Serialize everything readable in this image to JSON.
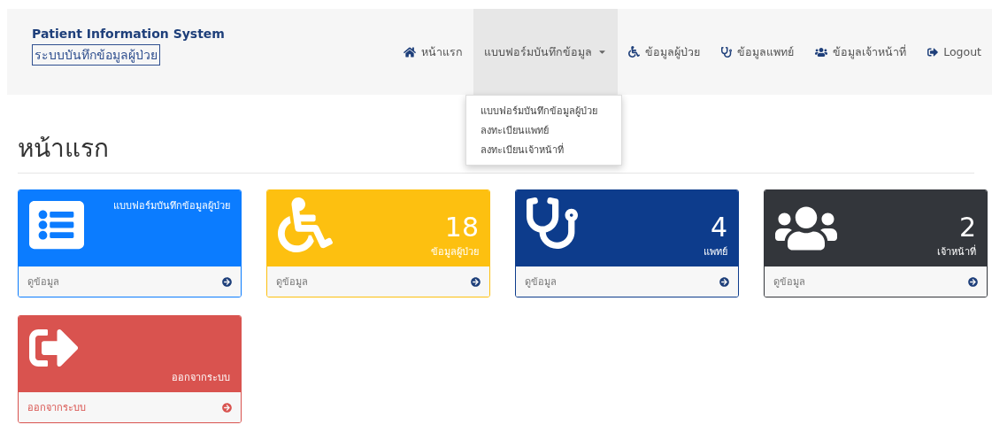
{
  "brand": {
    "title": "Patient Information System",
    "subtitle": "ระบบบันทึกข้อมูลผู้ป่วย"
  },
  "nav": [
    {
      "label": "หน้าแรก",
      "kind": "link",
      "active": false
    },
    {
      "label": "แบบฟอร์มบันทึกข้อมูล",
      "kind": "dropdown",
      "active": true
    },
    {
      "label": "ข้อมูลผู้ป่วย",
      "kind": "link",
      "active": false
    },
    {
      "label": "ข้อมูลแพทย์",
      "kind": "link",
      "active": false
    },
    {
      "label": "ข้อมูลเจ้าหน้าที่",
      "kind": "link",
      "active": false
    },
    {
      "label": "Logout",
      "kind": "link",
      "active": false
    }
  ],
  "dropdown_menu": [
    "แบบฟอร์มบันทึกข้อมูลผู้ป่วย",
    "ลงทะเบียนแพทย์",
    "ลงทะเบียนเจ้าหน้าที่"
  ],
  "page_title": "หน้าแรก",
  "panels": [
    {
      "kind": "form",
      "color": "#0b7cff",
      "label": "แบบฟอร์มบันทึกข้อมูลผู้ป่วย",
      "link": "ดูข้อมูล"
    },
    {
      "kind": "stat",
      "color": "#fdc010",
      "count": "18",
      "label": "ข้อมูลผู้ป่วย",
      "link": "ดูข้อมูล"
    },
    {
      "kind": "stat",
      "color": "#0d3c8c",
      "count": "4",
      "label": "แพทย์",
      "link": "ดูข้อมูล"
    },
    {
      "kind": "stat",
      "color": "#33363b",
      "count": "2",
      "label": "เจ้าหน้าที่",
      "link": "ดูข้อมูล"
    },
    {
      "kind": "action",
      "color": "#d9534f",
      "label": "ออกจากระบบ",
      "link": "ออกจากระบบ"
    }
  ]
}
